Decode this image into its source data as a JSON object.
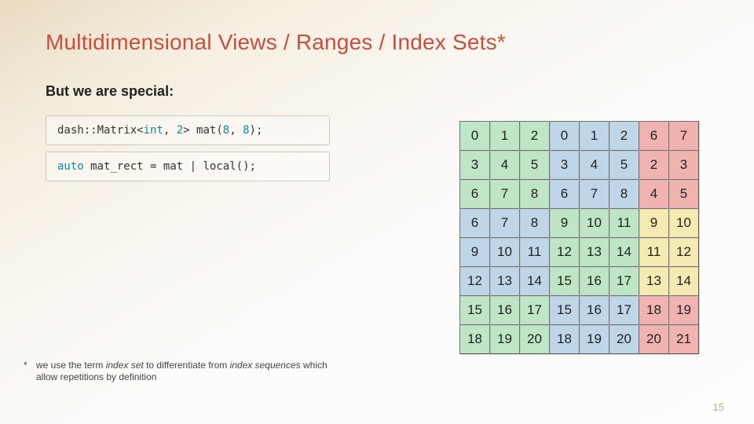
{
  "slide": {
    "title": "Multidimensional Views / Ranges / Index Sets*",
    "subtitle": "But we are special:",
    "page_number": "15"
  },
  "code": {
    "line1": {
      "t01_ns": "dash",
      "t02_p": "::",
      "t03_cls": "Matrix",
      "t04_lt": "<",
      "t05_int": "int",
      "t06_c": ", ",
      "t07_dim": "2",
      "t08_gt": "> ",
      "t09_var": "mat",
      "t10_lp": "(",
      "t11_a": "8",
      "t12_c2": ", ",
      "t13_b": "8",
      "t14_rp": ")",
      "t15_semi": ";"
    },
    "line2": {
      "t01_auto": "auto",
      "t02_sp": " ",
      "t03_var": "mat_rect",
      "t04_eq": " = ",
      "t05_src": "mat",
      "t06_pipe": " | ",
      "t07_fn": "local",
      "t08_pp": "();"
    }
  },
  "chart_data": {
    "type": "table",
    "title": "8×8 matrix partitioned into four 3-column / 2-column local blocks",
    "rows": 8,
    "cols": 8,
    "values": [
      [
        0,
        1,
        2,
        0,
        1,
        2,
        6,
        7
      ],
      [
        3,
        4,
        5,
        3,
        4,
        5,
        2,
        3
      ],
      [
        6,
        7,
        8,
        6,
        7,
        8,
        4,
        5
      ],
      [
        6,
        7,
        8,
        9,
        10,
        11,
        9,
        10
      ],
      [
        9,
        10,
        11,
        12,
        13,
        14,
        11,
        12
      ],
      [
        12,
        13,
        14,
        15,
        16,
        17,
        13,
        14
      ],
      [
        15,
        16,
        17,
        15,
        16,
        17,
        18,
        19
      ],
      [
        18,
        19,
        20,
        18,
        19,
        20,
        20,
        21
      ]
    ],
    "block_color": [
      [
        "green",
        "green",
        "green",
        "blue",
        "blue",
        "blue",
        "red",
        "red"
      ],
      [
        "green",
        "green",
        "green",
        "blue",
        "blue",
        "blue",
        "red",
        "red"
      ],
      [
        "green",
        "green",
        "green",
        "blue",
        "blue",
        "blue",
        "red",
        "red"
      ],
      [
        "blue",
        "blue",
        "blue",
        "green",
        "green",
        "green",
        "yellow",
        "yellow"
      ],
      [
        "blue",
        "blue",
        "blue",
        "green",
        "green",
        "green",
        "yellow",
        "yellow"
      ],
      [
        "blue",
        "blue",
        "blue",
        "green",
        "green",
        "green",
        "yellow",
        "yellow"
      ],
      [
        "green",
        "green",
        "green",
        "blue",
        "blue",
        "blue",
        "red",
        "red"
      ],
      [
        "green",
        "green",
        "green",
        "blue",
        "blue",
        "blue",
        "red",
        "red"
      ]
    ],
    "legend": {
      "green": "#bee5c6",
      "blue": "#bfd6e8",
      "red": "#f0b3b0",
      "yellow": "#f4eab2"
    }
  },
  "footnote": {
    "marker": "*",
    "pre": "we use the term ",
    "em1": "index set",
    "mid": " to differentiate from ",
    "em2": "index sequences",
    "post": " which allow repetitions by definition"
  }
}
